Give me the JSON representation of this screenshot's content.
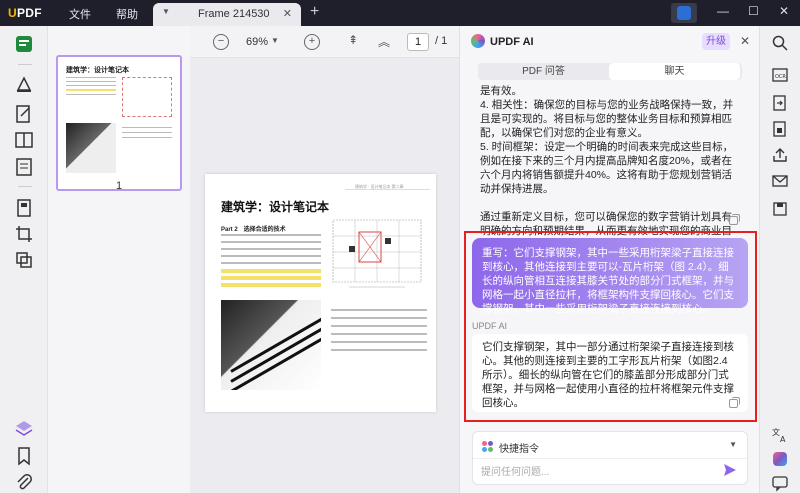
{
  "app": {
    "logo": "UPDF",
    "menu": [
      "文件",
      "帮助"
    ],
    "tab_title": "Frame 214530"
  },
  "toolbar": {
    "zoom": "69%",
    "current_page": "1",
    "total_pages": "/ 1"
  },
  "thumbnails": {
    "page_label": "1"
  },
  "document": {
    "header": "建筑学 · 设计笔记本 第二章",
    "title": "建筑学：设计笔记本",
    "subtitle": "Part 2　选择合适的技术"
  },
  "ai": {
    "title": "UPDF AI",
    "upgrade": "升级",
    "tabs": [
      "PDF 问答",
      "聊天"
    ],
    "previous_response": [
      "是有效。",
      "4. 相关性：确保您的目标与您的业务战略保持一致，并且是可实现的。将目标与您的整体业务目标和预算相匹配，以确保它们对您的企业有意义。",
      "5. 时间框架：设定一个明确的时间表来完成这些目标，例如在接下来的三个月内提高品牌知名度20%，或者在六个月内将销售额提升40%。这将有助于您规划营销活动并保持进展。",
      "通过重新定义目标，您可以确保您的数字营销计划具有明确的方向和预期结果，从而更有效地实现您的商业目标。"
    ],
    "user_message": "重写：它们支撑钢架，其中一些采用桁架梁子直接连接到核心，其他连接到主要可以-瓦片桁架（图 2.4）。细长的纵向管相互连接其膝关节处的部分门式框架，并与网格一起小直径拉杆，将框架构件支撑回核心。它们支撑钢架，其中一些采用桁架梁子直接连接到核心。",
    "response_label": "UPDF AI",
    "response": "它们支撑钢架，其中一部分通过桁架梁子直接连接到核心。其他的则连接到主要的工字形瓦片桁架（如图2.4所示）。细长的纵向管在它们的膝盖部分形成部分门式框架，并与网格一起使用小直径的拉杆将框架元件支撑回核心。",
    "quick_label": "快捷指令",
    "input_placeholder": "提问任何问题..."
  },
  "colors": {
    "accent": "#8d67ea",
    "highlight_box": "#e62020",
    "titlebar": "#1e1f2b"
  }
}
